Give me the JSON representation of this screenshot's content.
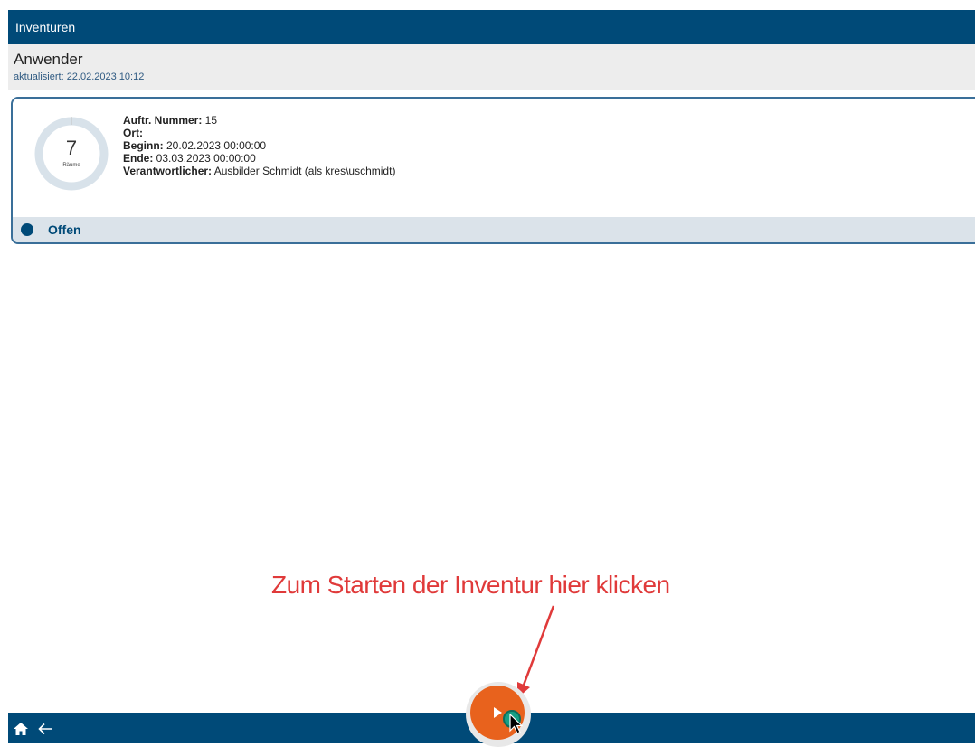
{
  "header": {
    "title": "Inventuren"
  },
  "subheader": {
    "title": "Anwender",
    "updated": "aktualisiert: 22.02.2023 10:12"
  },
  "inventory_card": {
    "room_count": "7",
    "room_unit": "Räume",
    "fields": [
      {
        "label": "Auftr. Nummer:",
        "value": " 15"
      },
      {
        "label": "Ort:",
        "value": ""
      },
      {
        "label": "Beginn:",
        "value": " 20.02.2023 00:00:00"
      },
      {
        "label": "Ende:",
        "value": " 03.03.2023 00:00:00"
      },
      {
        "label": "Verantwortlicher:",
        "value": " Ausbilder Schmidt (als kres\\uschmidt)"
      }
    ],
    "status": "Offen"
  },
  "annotation": {
    "text": "Zum Starten der Inventur hier klicken"
  },
  "bottom_nav": {
    "home_icon": "home-icon",
    "back_icon": "arrow-left-icon",
    "fab_icon": "play-icon"
  },
  "colors": {
    "primary": "#004a78",
    "fab": "#e8621d",
    "annotation": "#e03a3a",
    "status_bg": "#dbe3ea"
  }
}
